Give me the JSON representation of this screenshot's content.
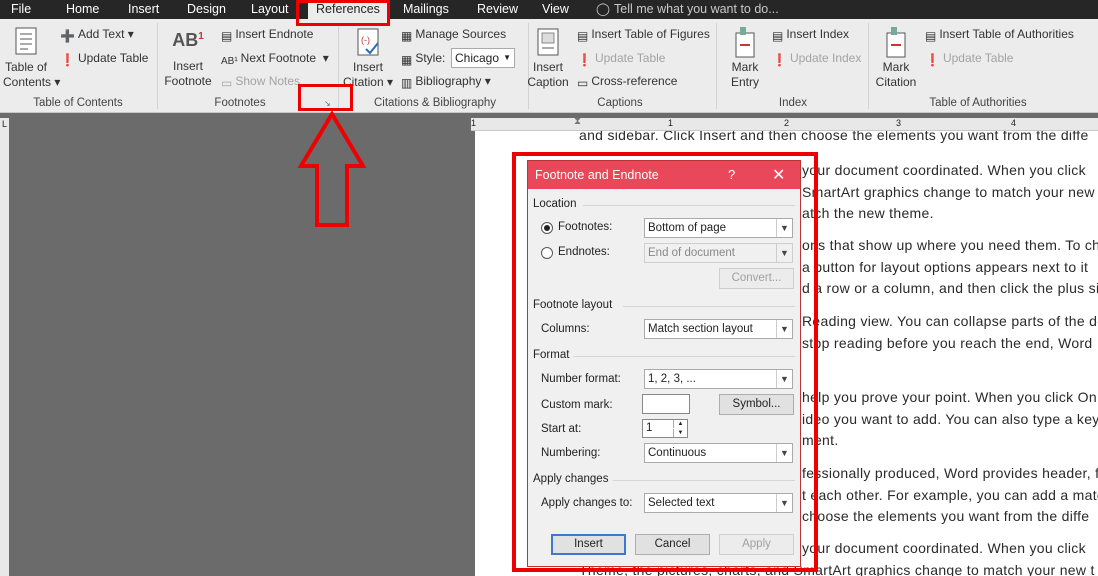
{
  "tabs": [
    "File",
    "Home",
    "Insert",
    "Design",
    "Layout",
    "References",
    "Mailings",
    "Review",
    "View"
  ],
  "tell_me": "Tell me what you want to do...",
  "ribbon": {
    "toc": {
      "big_line1": "Table of",
      "big_line2": "Contents",
      "add_text": "Add Text",
      "update_table": "Update Table",
      "group": "Table of Contents"
    },
    "footnotes": {
      "big_line1": "Insert",
      "big_line2": "Footnote",
      "insert_endnote": "Insert Endnote",
      "next_footnote": "Next Footnote",
      "show_notes": "Show Notes",
      "group": "Footnotes"
    },
    "citations": {
      "big_line1": "Insert",
      "big_line2": "Citation",
      "manage_sources": "Manage Sources",
      "style_label": "Style:",
      "style_value": "Chicago",
      "bibliography": "Bibliography",
      "group": "Citations & Bibliography"
    },
    "captions": {
      "big_line1": "Insert",
      "big_line2": "Caption",
      "insert_tof": "Insert Table of Figures",
      "update_table": "Update Table",
      "cross_ref": "Cross-reference",
      "group": "Captions"
    },
    "index": {
      "big_line1": "Mark",
      "big_line2": "Entry",
      "insert_index": "Insert Index",
      "update_index": "Update Index",
      "group": "Index"
    },
    "toa": {
      "big_line1": "Mark",
      "big_line2": "Citation",
      "insert_toa": "Insert Table of Authorities",
      "update_table": "Update Table",
      "group": "Table of Authorities"
    }
  },
  "ruler_numbers": [
    "1",
    "1",
    "2",
    "3",
    "4"
  ],
  "page_lines": [
    "and sidebar. Click Insert and then choose the elements you want from the diffe",
    "your document coordinated. When you click",
    "SmartArt graphics change to match your new t",
    "atch the new theme.",
    "ons that show up where you need them. To ch",
    "a button for layout options appears next to it",
    "d a row or a column, and then click the plus si",
    "Reading view. You can collapse parts of the do",
    "stop reading before you reach the end, Word",
    "help you prove your point. When you click On",
    "ideo you want to add. You can also type a key",
    "ment.",
    "fessionally produced, Word provides header, f",
    "t each other. For example, you can add a matc",
    "choose the elements you want from the diffe",
    "your document coordinated. When you click",
    "Theme, the pictures, charts, and SmartArt graphics change to match your new t"
  ],
  "dialog": {
    "title": "Footnote and Endnote",
    "help": "?",
    "close": "✕",
    "location": "Location",
    "footnotes_label": "Footnotes:",
    "footnotes_value": "Bottom of page",
    "endnotes_label": "Endnotes:",
    "endnotes_value": "End of document",
    "convert": "Convert...",
    "footnote_layout": "Footnote layout",
    "columns_label": "Columns:",
    "columns_value": "Match section layout",
    "format": "Format",
    "number_format_label": "Number format:",
    "number_format_value": "1, 2, 3, ...",
    "custom_mark_label": "Custom mark:",
    "custom_mark_value": "",
    "symbol": "Symbol...",
    "start_at_label": "Start at:",
    "start_at_value": "1",
    "numbering_label": "Numbering:",
    "numbering_value": "Continuous",
    "apply_changes": "Apply changes",
    "apply_to_label": "Apply changes to:",
    "apply_to_value": "Selected text",
    "insert": "Insert",
    "cancel": "Cancel",
    "apply": "Apply"
  },
  "colors": {
    "highlight": "#e00000",
    "dialog_title": "#e8485a",
    "tabbar": "#262626"
  }
}
